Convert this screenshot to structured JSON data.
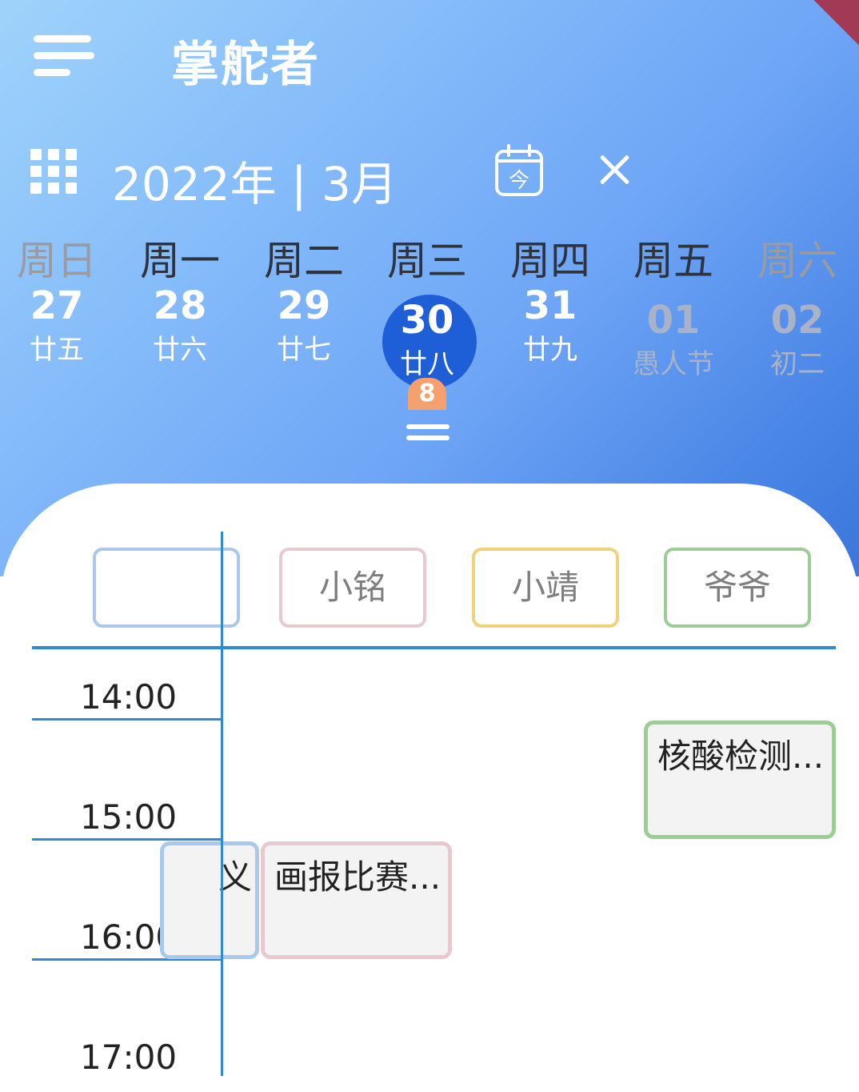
{
  "app": {
    "title": "掌舵者"
  },
  "calendar": {
    "month_label": "2022年 | 3月",
    "today_icon_glyph": "今",
    "weekdays": [
      "周日",
      "周一",
      "周二",
      "周三",
      "周四",
      "周五",
      "周六"
    ],
    "days": [
      {
        "num": "27",
        "lunar": "廿五"
      },
      {
        "num": "28",
        "lunar": "廿六"
      },
      {
        "num": "29",
        "lunar": "廿七"
      },
      {
        "num": "30",
        "lunar": "廿八",
        "selected": true,
        "badge": "8"
      },
      {
        "num": "31",
        "lunar": "廿九"
      },
      {
        "num": "01",
        "lunar": "愚人节"
      },
      {
        "num": "02",
        "lunar": "初二"
      }
    ]
  },
  "schedule": {
    "members": [
      {
        "name": "",
        "color": "#a9c8ec"
      },
      {
        "name": "小铭",
        "color": "#e8c9cf"
      },
      {
        "name": "小靖",
        "color": "#f1d27a"
      },
      {
        "name": "爷爷",
        "color": "#9ccd94"
      }
    ],
    "times": [
      "14:00",
      "15:00",
      "16:00",
      "17:00"
    ],
    "events": [
      {
        "title": "核酸检测...",
        "color": "#9ccd94"
      },
      {
        "title": "画报比赛...",
        "color": "#e8c9cf"
      },
      {
        "title": "义",
        "color": "#a9c8ec"
      }
    ]
  },
  "colors": {
    "accent": "#2f89d6",
    "selected_day": "#1e5fd8",
    "badge": "#f4a06f"
  }
}
